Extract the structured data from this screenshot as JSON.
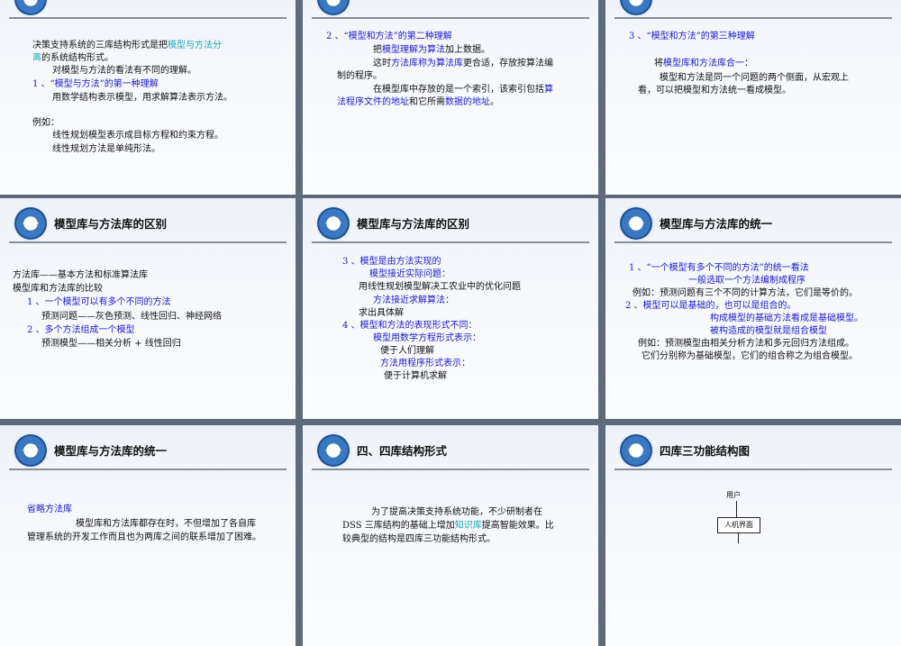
{
  "slides": [
    {
      "title": "",
      "lines": [
        [
          {
            "t": "决策支持系统的三库结构形式是把",
            "c": "blk"
          },
          {
            "t": "模型与方法分",
            "c": "teal"
          }
        ],
        [
          {
            "t": "离",
            "c": "teal"
          },
          {
            "t": "的系统结构形式。",
            "c": "blk"
          }
        ],
        [
          {
            "t": "对模型与方法的看法有不同的理解。",
            "c": "blk"
          }
        ],
        [
          {
            "t": "1 、“模型与方法”的第一种理解",
            "c": "blue"
          }
        ],
        [
          {
            "t": "用数学结构表示模型，用求解算法表示方法。",
            "c": "blk"
          }
        ],
        [
          {
            "t": "例如：",
            "c": "blk"
          }
        ],
        [
          {
            "t": "线性规划模型表示成目标方程和约束方程。",
            "c": "blk"
          }
        ],
        [
          {
            "t": "线性规划方法是单纯形法。",
            "c": "blk"
          }
        ]
      ]
    },
    {
      "title": "",
      "lines": [
        [
          {
            "t": "2 、“模型和方法”的第二种理解",
            "c": "blue"
          }
        ],
        [
          {
            "t": "把",
            "c": "blk"
          },
          {
            "t": "模型理解为算法",
            "c": "blue"
          },
          {
            "t": "加上数据。",
            "c": "blk"
          }
        ],
        [
          {
            "t": "这时",
            "c": "blk"
          },
          {
            "t": "方法库称为算法库",
            "c": "blue"
          },
          {
            "t": "更合适，存放按算法编",
            "c": "blk"
          }
        ],
        [
          {
            "t": "制的程序。",
            "c": "blk"
          }
        ],
        [
          {
            "t": "在模型库中存放的是一个索引，该索引包括",
            "c": "blk"
          },
          {
            "t": "算",
            "c": "blue"
          }
        ],
        [
          {
            "t": "法程序文件的地址",
            "c": "blue"
          },
          {
            "t": "和它所需",
            "c": "blk"
          },
          {
            "t": "数据的地址",
            "c": "blue"
          },
          {
            "t": "。",
            "c": "blk"
          }
        ]
      ]
    },
    {
      "title": "",
      "lines": [
        [
          {
            "t": "3 、“模型和方法”的第三种理解",
            "c": "blue"
          }
        ],
        [
          {
            "t": "将",
            "c": "blk"
          },
          {
            "t": "模型库和方法库合一",
            "c": "blue"
          },
          {
            "t": "：",
            "c": "blk"
          }
        ],
        [
          {
            "t": "模型和方法是同一个问题的两个侧面，从宏观上",
            "c": "blk"
          }
        ],
        [
          {
            "t": "看，可以把模型和方法统一看成模型。",
            "c": "blk"
          }
        ]
      ]
    },
    {
      "title": "模型库与方法库的区别",
      "lines": [
        [
          {
            "t": "方法库——基本方法和标准算法库",
            "c": "blk"
          }
        ],
        [
          {
            "t": "模型库和方法库的比较",
            "c": "blk"
          }
        ],
        [
          {
            "t": "1 、一个模型可以有多个不同的方法",
            "c": "blue"
          }
        ],
        [
          {
            "t": "预测问题——灰色预测、线性回归、神经网络",
            "c": "blk"
          }
        ],
        [
          {
            "t": "2 、多个方法组成一个模型",
            "c": "blue"
          }
        ],
        [
          {
            "t": "预测模型——相关分析 + 线性回归",
            "c": "blk"
          }
        ]
      ]
    },
    {
      "title": "模型库与方法库的区别",
      "lines": [
        [
          {
            "t": "3 、模型是由方法实现的",
            "c": "blue"
          }
        ],
        [
          {
            "t": "模型接近实际问题：",
            "c": "blue"
          }
        ],
        [
          {
            "t": "用线性规划模型解决工农业中的优化问题",
            "c": "blk"
          }
        ],
        [
          {
            "t": "方法接近求解算法：",
            "c": "blue"
          }
        ],
        [
          {
            "t": "求出具体解",
            "c": "blk"
          }
        ],
        [
          {
            "t": "4 、模型和方法的表现形式不同：",
            "c": "blue"
          }
        ],
        [
          {
            "t": "模型用数学方程形式表示：",
            "c": "blue"
          }
        ],
        [
          {
            "t": "便于人们理解",
            "c": "blk"
          }
        ],
        [
          {
            "t": "方法用程序形式表示：",
            "c": "blue"
          }
        ],
        [
          {
            "t": "便于计算机求解",
            "c": "blk"
          }
        ]
      ]
    },
    {
      "title": "模型库与方法库的统一",
      "lines": [
        [
          {
            "t": "1 、“一个模型有多个不同的方法”的统一看法",
            "c": "blue"
          }
        ],
        [
          {
            "t": "一般选取一个方法编制成程序",
            "c": "blue"
          }
        ],
        [
          {
            "t": "例如：预测问题有三个不同的计算方法，它们是等价的。",
            "c": "blk"
          }
        ],
        [
          {
            "t": "2 、模型可以是基础的，也可以是组合的。",
            "c": "blue"
          }
        ],
        [
          {
            "t": "构成模型的基础方法看成是基础模型。",
            "c": "blue"
          }
        ],
        [
          {
            "t": "被构造成的模型就是组合模型",
            "c": "blue"
          }
        ],
        [
          {
            "t": "例如：预测模型由相关分析方法和多元回归方法组成。",
            "c": "blk"
          }
        ],
        [
          {
            "t": "它们分别称为基础模型，它们的组合称之为组合模型。",
            "c": "blk"
          }
        ]
      ]
    },
    {
      "title": "模型库与方法库的统一",
      "lines": [
        [
          {
            "t": "省略方法库",
            "c": "blue"
          }
        ],
        [
          {
            "t": "模型库和方法库都存在时，不但增加了各自库",
            "c": "blk"
          }
        ],
        [
          {
            "t": "管理系统的开发工作而且也为两库之间的联系增加了困难。",
            "c": "blk"
          }
        ]
      ]
    },
    {
      "title": "四、四库结构形式",
      "lines": [
        [
          {
            "t": "为了提高决策支持系统功能，不少研制者在",
            "c": "blk"
          }
        ],
        [
          {
            "t": "DSS 三库结构的基础上增加",
            "c": "blk"
          },
          {
            "t": "知识库",
            "c": "teal"
          },
          {
            "t": "提高智能效果。比",
            "c": "blk"
          }
        ],
        [
          {
            "t": "较典型的结构是四库三功能结构形式。",
            "c": "blk"
          }
        ]
      ]
    },
    {
      "title": "四库三功能结构图",
      "diagram": {
        "user": "用户",
        "interface": "人机界面"
      }
    }
  ]
}
